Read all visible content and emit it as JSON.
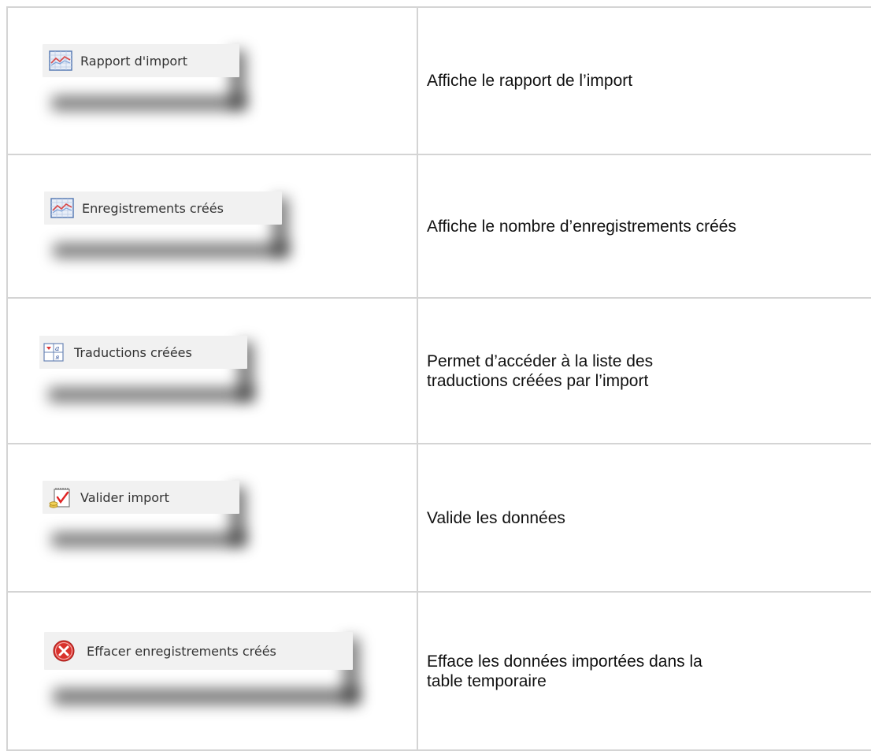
{
  "rows": [
    {
      "button_label": "Rapport d'import",
      "icon": "chart-icon",
      "description": "Affiche le rapport de l’import"
    },
    {
      "button_label": "Enregistrements créés",
      "icon": "chart-icon",
      "description": "Affiche le nombre d’enregistrements créés"
    },
    {
      "button_label": "Traductions créées",
      "icon": "translation-icon",
      "description": "Permet d’accéder à la liste des traductions créées par l’import"
    },
    {
      "button_label": "Valider import",
      "icon": "validate-notepad-icon",
      "description": "Valide les données"
    },
    {
      "button_label": "Effacer enregistrements créés",
      "icon": "delete-circle-icon",
      "description": "Efface les données importées dans la table temporaire"
    }
  ],
  "colors": {
    "border": "#d4d4d4",
    "button_bg": "#f1f1f1",
    "delete_red": "#d9312c"
  }
}
